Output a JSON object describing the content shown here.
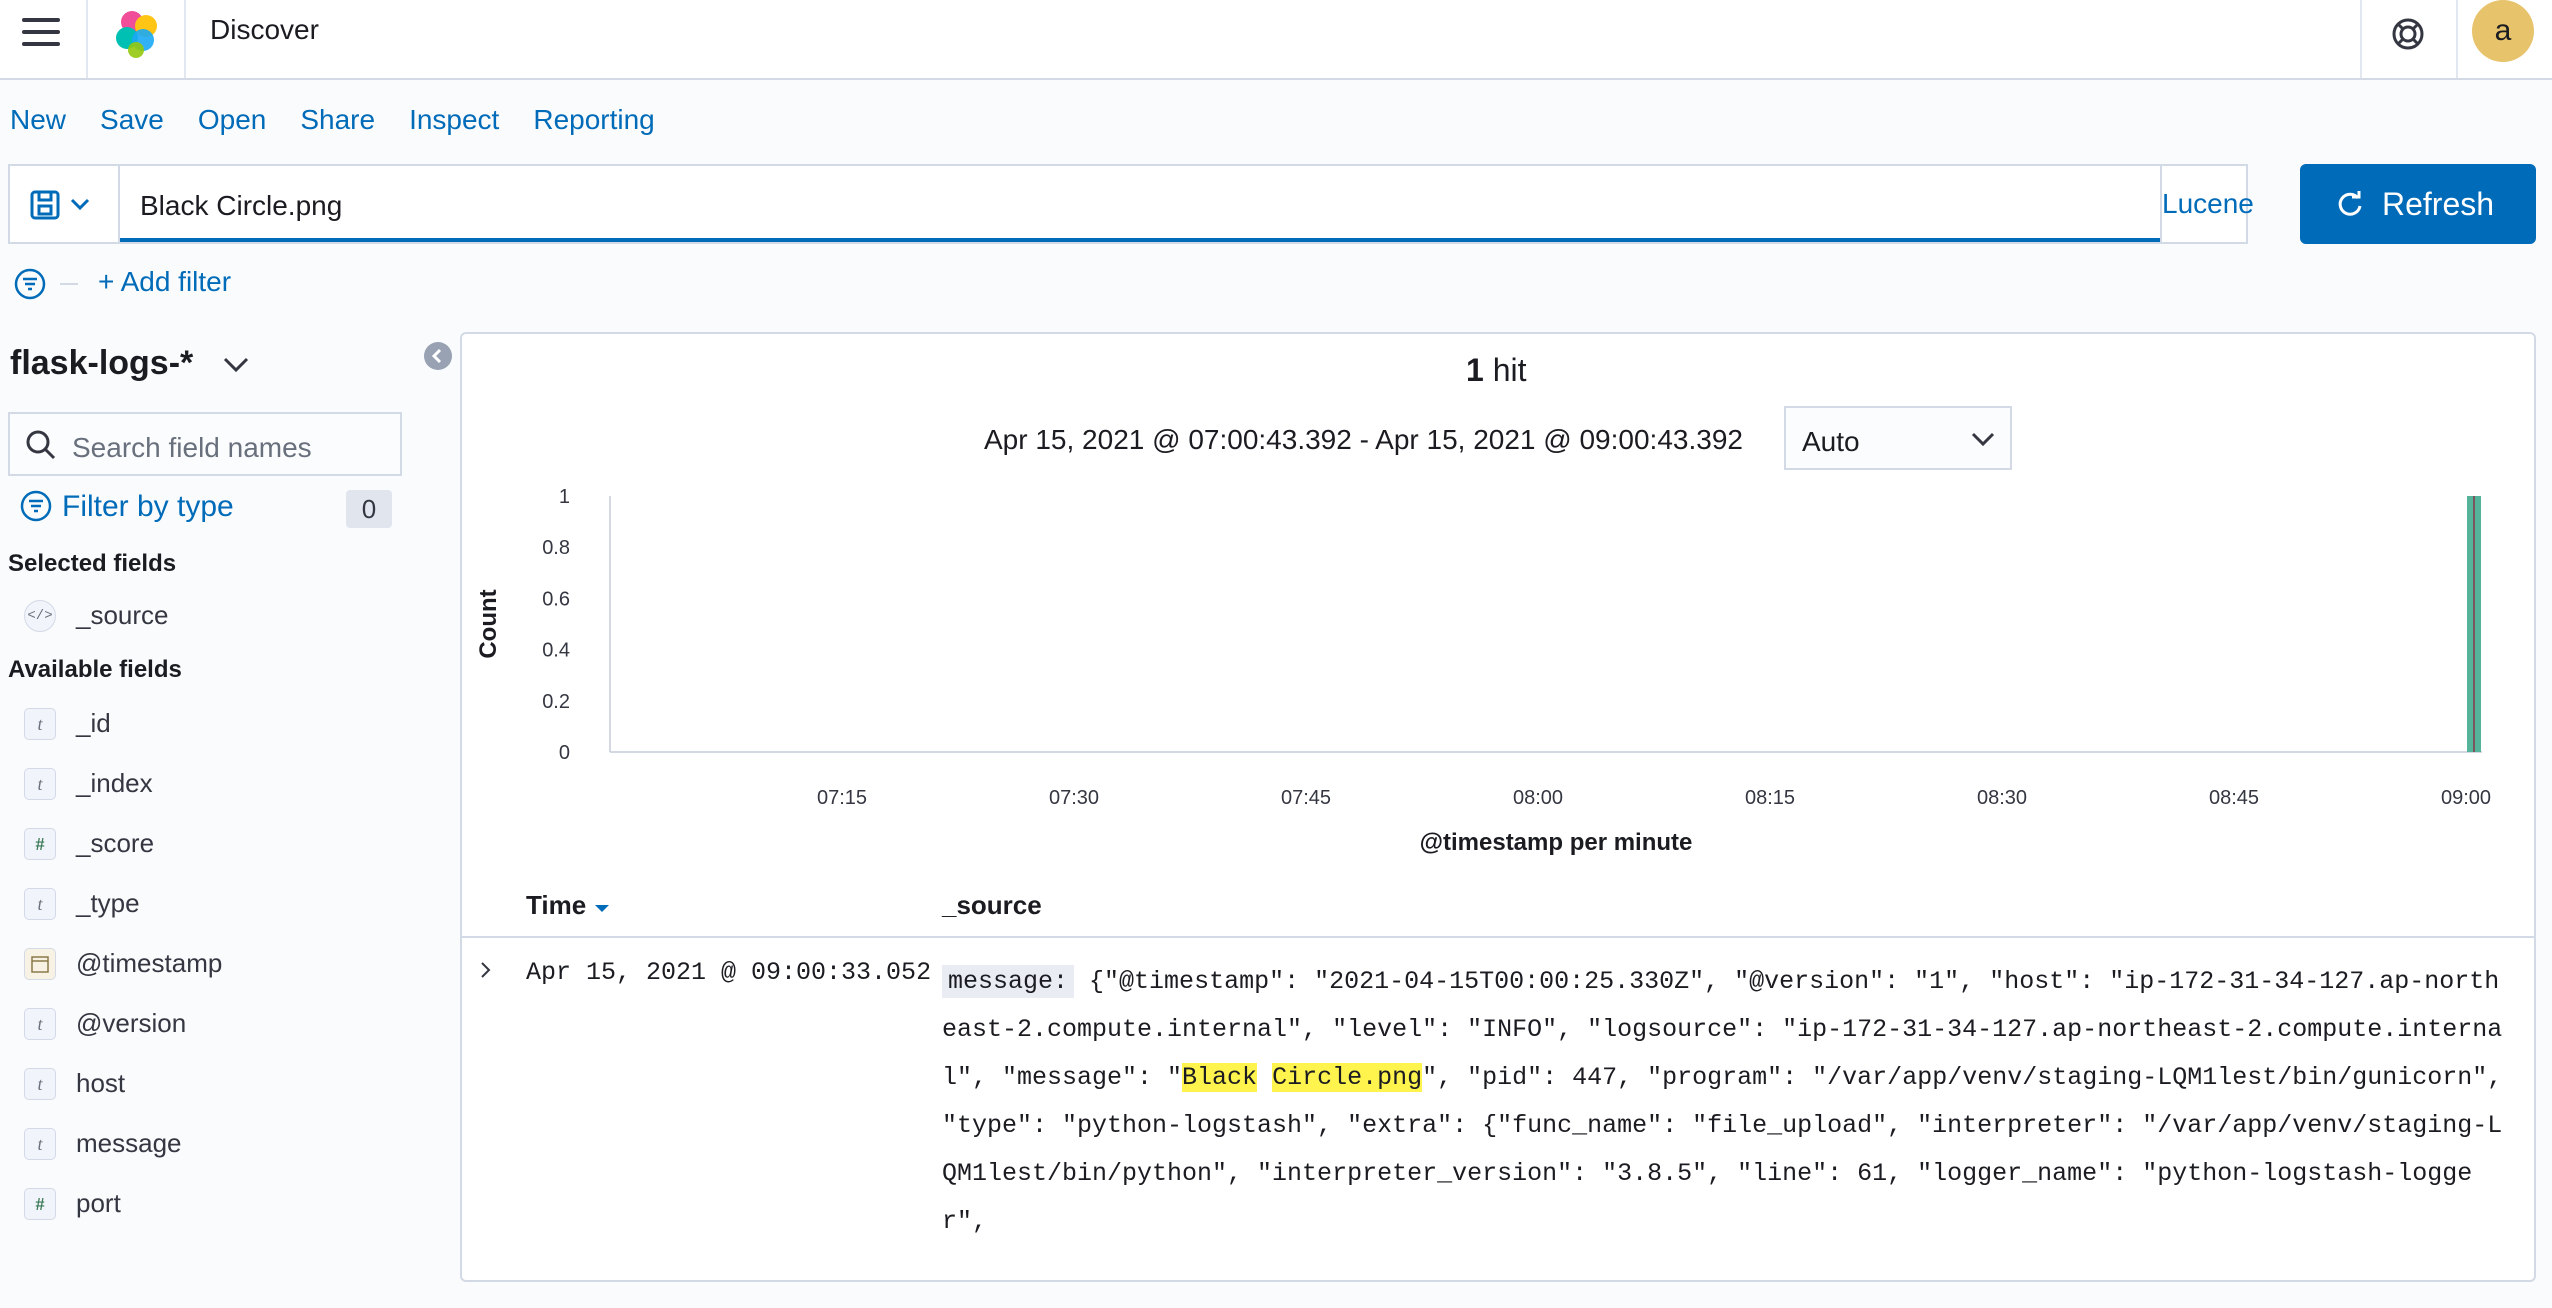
{
  "header": {
    "title": "Discover",
    "avatar_letter": "a"
  },
  "menu": {
    "new": "New",
    "save": "Save",
    "open": "Open",
    "share": "Share",
    "inspect": "Inspect",
    "reporting": "Reporting"
  },
  "query": {
    "value": "Black Circle.png",
    "language": "Lucene",
    "refresh_label": "Refresh"
  },
  "filters": {
    "add_label": "+ Add filter"
  },
  "sidebar": {
    "index_pattern": "flask-logs-*",
    "search_placeholder": "Search field names",
    "filter_by_type": "Filter by type",
    "filter_count": "0",
    "selected_heading": "Selected fields",
    "available_heading": "Available fields",
    "selected_fields": [
      {
        "type": "source",
        "name": "_source"
      }
    ],
    "available_fields": [
      {
        "type": "t",
        "name": "_id"
      },
      {
        "type": "t",
        "name": "_index"
      },
      {
        "type": "#",
        "name": "_score"
      },
      {
        "type": "t",
        "name": "_type"
      },
      {
        "type": "date",
        "name": "@timestamp"
      },
      {
        "type": "t",
        "name": "@version"
      },
      {
        "type": "t",
        "name": "host"
      },
      {
        "type": "t",
        "name": "message"
      },
      {
        "type": "#",
        "name": "port"
      }
    ]
  },
  "results": {
    "hit_count": "1",
    "hit_label": "hit",
    "time_range": "Apr 15, 2021 @ 07:00:43.392 - Apr 15, 2021 @ 09:00:43.392",
    "interval": "Auto",
    "columns": {
      "time": "Time",
      "source": "_source"
    },
    "rows": [
      {
        "time": "Apr 15, 2021 @ 09:00:33.052",
        "message_label": "message:",
        "source_pre": "{\"@timestamp\": \"2021-04-15T00:00:25.330Z\", \"@version\": \"1\", \"host\": \"ip-172-31-34-127.ap-northeast-2.compute.internal\", \"level\": \"INFO\", \"logsource\": \"ip-172-31-34-127.ap-northeast-2.compute.internal\", \"message\": \"",
        "hl1": "Black",
        "hl2": "Circle.png",
        "source_post": "\", \"pid\": 447, \"program\": \"/var/app/venv/staging-LQM1lest/bin/gunicorn\", \"type\": \"python-logstash\", \"extra\": {\"func_name\": \"file_upload\", \"interpreter\": \"/var/app/venv/staging-LQM1lest/bin/python\", \"interpreter_version\": \"3.8.5\", \"line\": 61, \"logger_name\": \"python-logstash-logger\","
      }
    ]
  },
  "chart_data": {
    "type": "bar",
    "title": "",
    "xlabel": "@timestamp per minute",
    "ylabel": "Count",
    "yticks": [
      "0",
      "0.2",
      "0.4",
      "0.6",
      "0.8",
      "1"
    ],
    "ylim": [
      0,
      1
    ],
    "xticks": [
      "07:15",
      "07:30",
      "07:45",
      "08:00",
      "08:15",
      "08:30",
      "08:45",
      "09:00"
    ],
    "series": [
      {
        "x": [
          "09:00"
        ],
        "values": [
          1
        ]
      }
    ],
    "bar_color": "#54b399"
  }
}
